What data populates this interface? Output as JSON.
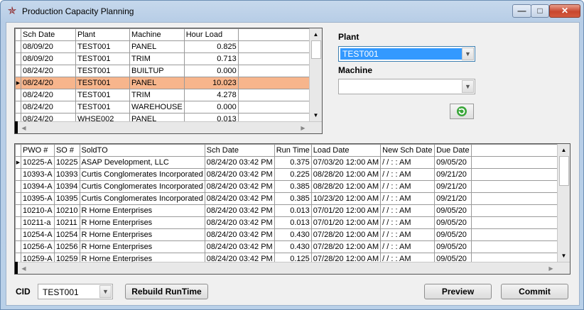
{
  "window": {
    "title": "Production Capacity Planning",
    "min_glyph": "—",
    "max_glyph": "□",
    "close_glyph": "✕"
  },
  "top_grid": {
    "columns": [
      "Sch Date",
      "Plant",
      "Machine",
      "Hour Load"
    ],
    "selected_row": 3,
    "rows": [
      [
        "08/09/20",
        "TEST001",
        "PANEL",
        "0.825"
      ],
      [
        "08/09/20",
        "TEST001",
        "TRIM",
        "0.713"
      ],
      [
        "08/24/20",
        "TEST001",
        "BUILTUP",
        "0.000"
      ],
      [
        "08/24/20",
        "TEST001",
        "PANEL",
        "10.023"
      ],
      [
        "08/24/20",
        "TEST001",
        "TRIM",
        "4.278"
      ],
      [
        "08/24/20",
        "TEST001",
        "WAREHOUSE",
        "0.000"
      ],
      [
        "08/24/20",
        "WHSE002",
        "PANEL",
        "0.013"
      ]
    ]
  },
  "filters": {
    "plant_label": "Plant",
    "plant_value": "TEST001",
    "machine_label": "Machine",
    "machine_value": ""
  },
  "bottom_grid": {
    "columns": [
      "PWO #",
      "SO #",
      "SoldTO",
      "Sch Date",
      "Run Time",
      "Load Date",
      "New Sch Date",
      "Due Date"
    ],
    "current_row": 0,
    "rows": [
      [
        "10225-A",
        "10225",
        "ASAP Development, LLC",
        "08/24/20 03:42 PM",
        "0.375",
        "07/03/20 12:00 AM",
        "/  /      :  :   AM",
        "09/05/20"
      ],
      [
        "10393-A",
        "10393",
        "Curtis Conglomerates Incorporated",
        "08/24/20 03:42 PM",
        "0.225",
        "08/28/20 12:00 AM",
        "/  /      :  :   AM",
        "09/21/20"
      ],
      [
        "10394-A",
        "10394",
        "Curtis Conglomerates Incorporated",
        "08/24/20 03:42 PM",
        "0.385",
        "08/28/20 12:00 AM",
        "/  /      :  :   AM",
        "09/21/20"
      ],
      [
        "10395-A",
        "10395",
        "Curtis Conglomerates Incorporated",
        "08/24/20 03:42 PM",
        "0.385",
        "10/23/20 12:00 AM",
        "/  /      :  :   AM",
        "09/21/20"
      ],
      [
        "10210-A",
        "10210",
        "R Horne Enterprises",
        "08/24/20 03:42 PM",
        "0.013",
        "07/01/20 12:00 AM",
        "/  /      :  :   AM",
        "09/05/20"
      ],
      [
        "10211-a",
        "10211",
        "R Horne Enterprises",
        "08/24/20 03:42 PM",
        "0.013",
        "07/01/20 12:00 AM",
        "/  /      :  :   AM",
        "09/05/20"
      ],
      [
        "10254-A",
        "10254",
        "R Horne Enterprises",
        "08/24/20 03:42 PM",
        "0.430",
        "07/28/20 12:00 AM",
        "/  /      :  :   AM",
        "09/05/20"
      ],
      [
        "10256-A",
        "10256",
        "R Horne Enterprises",
        "08/24/20 03:42 PM",
        "0.430",
        "07/28/20 12:00 AM",
        "/  /      :  :   AM",
        "09/05/20"
      ],
      [
        "10259-A",
        "10259",
        "R Horne Enterprises",
        "08/24/20 03:42 PM",
        "0.125",
        "07/28/20 12:00 AM",
        "/  /      :  :   AM",
        "09/05/20"
      ]
    ]
  },
  "footer": {
    "cid_label": "CID",
    "cid_value": "TEST001",
    "rebuild_label": "Rebuild RunTime",
    "preview_label": "Preview",
    "commit_label": "Commit"
  },
  "colors": {
    "selected_row": "#f7b58c",
    "combo_highlight": "#3399ff",
    "refresh_icon": "#3aa63a"
  }
}
